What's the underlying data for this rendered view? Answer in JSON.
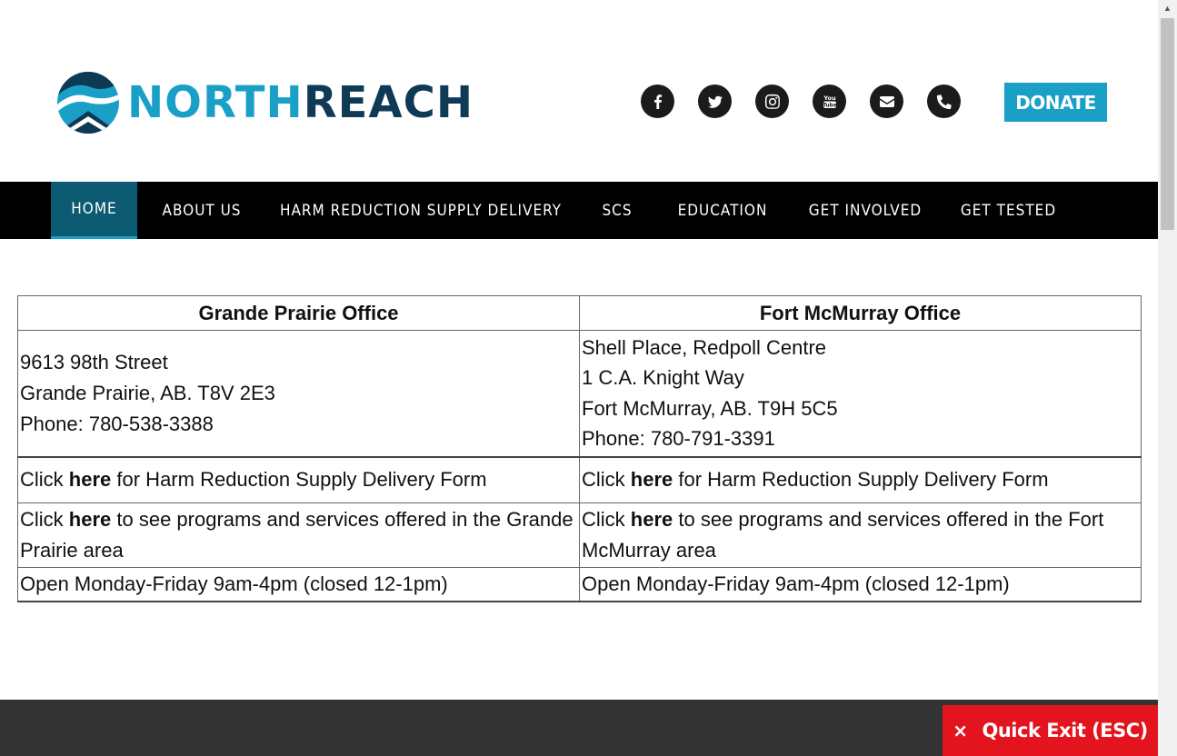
{
  "brand": {
    "name_part1": "NORTH",
    "name_part2": "REACH"
  },
  "social": [
    {
      "name": "facebook-icon"
    },
    {
      "name": "twitter-icon"
    },
    {
      "name": "instagram-icon"
    },
    {
      "name": "youtube-icon"
    },
    {
      "name": "email-icon"
    },
    {
      "name": "phone-icon"
    }
  ],
  "donate_label": "DONATE",
  "nav": [
    "HOME",
    "ABOUT US",
    "HARM REDUCTION SUPPLY DELIVERY",
    "SCS",
    "EDUCATION",
    "GET INVOLVED",
    "GET TESTED"
  ],
  "offices": {
    "gp": {
      "title": "Grande Prairie Office",
      "address": [
        "9613 98th Street",
        "Grande Prairie, AB. T8V 2E3",
        "Phone: 780-538-3388"
      ],
      "click": "Click",
      "here": "here",
      "form_rest": " for Harm Reduction Supply Delivery Form",
      "programs_rest": " to see programs and services offered in the Grande Prairie area",
      "hours": "Open Monday-Friday 9am-4pm (closed 12-1pm)"
    },
    "fm": {
      "title": "Fort McMurray Office",
      "address": [
        "Shell Place, Redpoll Centre",
        "1 C.A. Knight Way",
        "Fort McMurray, AB. T9H 5C5",
        "Phone: 780-791-3391"
      ],
      "click": "Click",
      "here": "here",
      "form_rest": " for Harm Reduction Supply Delivery Form",
      "programs_rest": " to see programs and services offered in the Fort McMurray area",
      "hours": "Open Monday-Friday 9am-4pm (closed 12-1pm)"
    }
  },
  "quick_exit": {
    "x": "×",
    "label": "Quick Exit (ESC)"
  },
  "colors": {
    "accent": "#1a9fc7",
    "navy": "#0f3a56",
    "nav_bg": "#000000",
    "active_nav": "#0d5a73",
    "exit_red": "#e3141d",
    "footer": "#333333"
  }
}
